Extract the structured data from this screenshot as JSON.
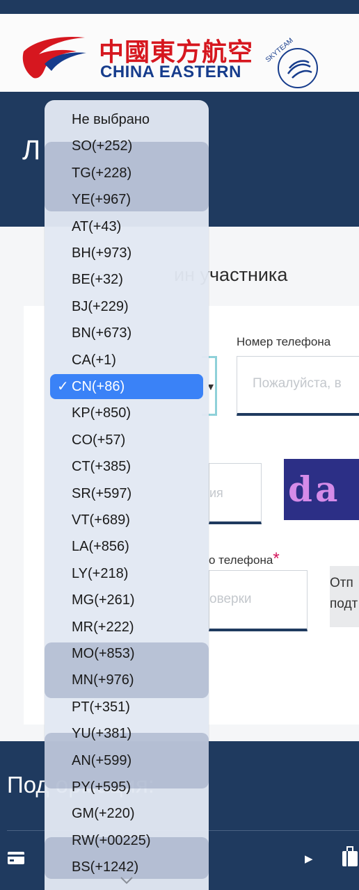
{
  "header": {
    "logo_chinese": "中國東方航空",
    "logo_english": "CHINA EASTERN",
    "skyteam": "SKYTEAM",
    "brand_red": "#d6171f",
    "brand_blue": "#163c8c"
  },
  "hero": {
    "title": "Л"
  },
  "form": {
    "tab_label": "ин участника",
    "phone_label": "Номер телефона",
    "phone_placeholder": "Пожалуйста, в",
    "captcha_placeholder": "ия",
    "captcha_text": "da",
    "sms_label": "о телефона",
    "sms_required": "*",
    "sms_placeholder": "оверки",
    "sms_button": "Отп подт"
  },
  "footer": {
    "title": "Под                          ормация:"
  },
  "dropdown": {
    "selected_index": 9,
    "check_mark": "✓",
    "options": [
      "Не выбрано",
      "SO(+252)",
      "TG(+228)",
      "YE(+967)",
      "AT(+43)",
      "BH(+973)",
      "BE(+32)",
      "BJ(+229)",
      "BN(+673)",
      "CA(+1)",
      "CN(+86)",
      "KP(+850)",
      "CO(+57)",
      "CT(+385)",
      "SR(+597)",
      "VT(+689)",
      "LA(+856)",
      "LY(+218)",
      "MG(+261)",
      "MR(+222)",
      "MO(+853)",
      "MN(+976)",
      "PT(+351)",
      "YU(+381)",
      "AN(+599)",
      "PY(+595)",
      "GM(+220)",
      "RW(+00225)",
      "BS(+1242)"
    ]
  },
  "colors": {
    "navy": "#1f3a5f",
    "selection": "#3a82f7"
  }
}
